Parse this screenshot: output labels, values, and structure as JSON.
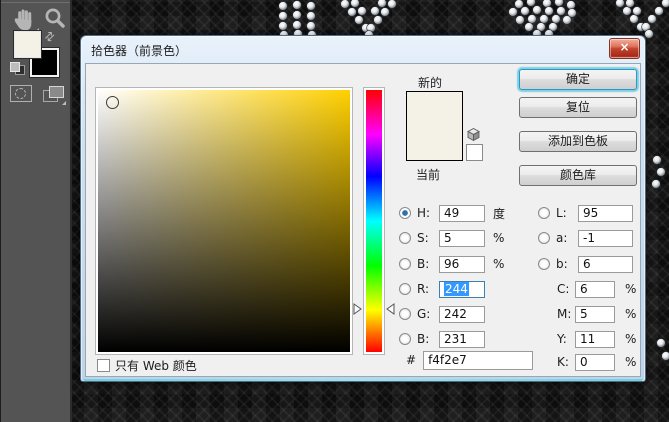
{
  "window": {
    "title": "拾色器（前景色）",
    "close_glyph": "×"
  },
  "toolbar": {
    "tools": [
      {
        "icon": "hand-tool-icon"
      },
      {
        "icon": "zoom-tool-icon"
      },
      {
        "icon": "swap-colors-icon"
      },
      {
        "icon": "default-colors-icon"
      },
      {
        "icon": "quick-mask-icon"
      },
      {
        "icon": "screen-mode-icon"
      }
    ],
    "foreground_color": "#f4f2e7",
    "background_color": "#000000"
  },
  "preview": {
    "new_label": "新的",
    "current_label": "当前",
    "new_color": "#f4f2e7",
    "current_color": "#f4f2e7"
  },
  "buttons": {
    "ok": "确定",
    "reset": "复位",
    "add_to_swatches": "添加到色板",
    "color_libraries": "颜色库"
  },
  "fields": {
    "hsb": [
      {
        "label": "H:",
        "value": "49",
        "unit": "度",
        "selected": true
      },
      {
        "label": "S:",
        "value": "5",
        "unit": "%",
        "selected": false
      },
      {
        "label": "B:",
        "value": "96",
        "unit": "%",
        "selected": false
      }
    ],
    "rgb": [
      {
        "label": "R:",
        "value": "244",
        "focused": true
      },
      {
        "label": "G:",
        "value": "242",
        "focused": false
      },
      {
        "label": "B:",
        "value": "231",
        "focused": false
      }
    ],
    "lab": [
      {
        "label": "L:",
        "value": "95"
      },
      {
        "label": "a:",
        "value": "-1"
      },
      {
        "label": "b:",
        "value": "6"
      }
    ],
    "cmyk": [
      {
        "label": "C:",
        "value": "6",
        "unit": "%"
      },
      {
        "label": "M:",
        "value": "5",
        "unit": "%"
      },
      {
        "label": "Y:",
        "value": "11",
        "unit": "%"
      },
      {
        "label": "K:",
        "value": "0",
        "unit": "%"
      }
    ],
    "hex": {
      "prefix": "#",
      "value": "f4f2e7"
    }
  },
  "web_only_checkbox": {
    "label": "只有 Web 颜色",
    "checked": false
  },
  "colors": {
    "picked": "#f4f2e7",
    "hue_base": "#ffd000",
    "selection_highlight": "#3399ff",
    "dialog_bg": "#f0f0f0",
    "titlebar": "#cfe0ef",
    "toolbar_bg": "#545454"
  }
}
